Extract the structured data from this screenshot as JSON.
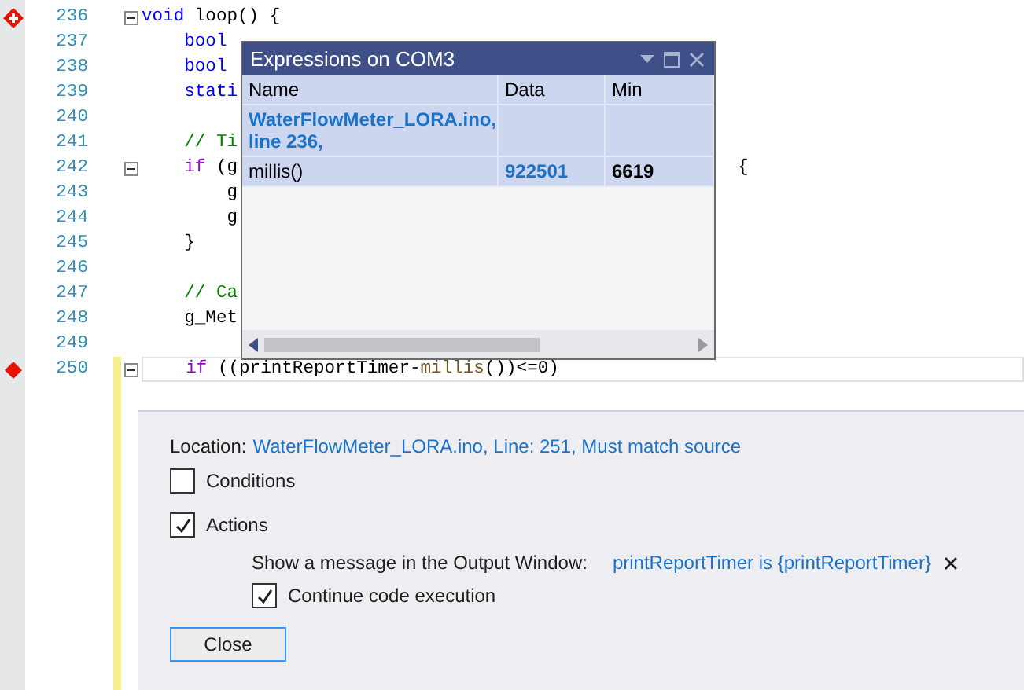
{
  "editor": {
    "lines": [
      {
        "number": "236",
        "breakpoint": {
          "kind": "diamond-plus"
        },
        "foldable": true,
        "changed": false,
        "segments": [
          {
            "kind": "keyword",
            "text": "void"
          },
          {
            "kind": "plain",
            "text": " loop() {"
          }
        ]
      },
      {
        "number": "237",
        "foldable": false,
        "changed": false,
        "segments": [
          {
            "kind": "keyword",
            "text": "    bool"
          }
        ]
      },
      {
        "number": "238",
        "foldable": false,
        "changed": false,
        "segments": [
          {
            "kind": "keyword",
            "text": "    bool"
          }
        ]
      },
      {
        "number": "239",
        "foldable": false,
        "changed": false,
        "segments": [
          {
            "kind": "keyword",
            "text": "    stati"
          }
        ]
      },
      {
        "number": "240",
        "foldable": false,
        "changed": false
      },
      {
        "number": "241",
        "foldable": false,
        "changed": false,
        "segments": [
          {
            "kind": "comment",
            "text": "    // Ti"
          }
        ]
      },
      {
        "number": "242",
        "foldable": true,
        "changed": false,
        "segments": [
          {
            "kind": "control",
            "text": "    if"
          },
          {
            "kind": "plain",
            "text": " (g"
          }
        ],
        "tail": "{"
      },
      {
        "number": "243",
        "foldable": false,
        "changed": false,
        "segments": [
          {
            "kind": "plain",
            "text": "        g"
          }
        ]
      },
      {
        "number": "244",
        "foldable": false,
        "changed": false,
        "segments": [
          {
            "kind": "plain",
            "text": "        g"
          }
        ]
      },
      {
        "number": "245",
        "foldable": false,
        "changed": false,
        "segments": [
          {
            "kind": "plain",
            "text": "    }"
          }
        ]
      },
      {
        "number": "246",
        "foldable": false,
        "changed": false
      },
      {
        "number": "247",
        "foldable": false,
        "changed": false,
        "segments": [
          {
            "kind": "comment",
            "text": "    // Ca"
          }
        ]
      },
      {
        "number": "248",
        "foldable": false,
        "changed": false,
        "segments": [
          {
            "kind": "plain",
            "text": "    g_Met"
          }
        ]
      },
      {
        "number": "249",
        "foldable": false,
        "changed": false
      },
      {
        "number": "250",
        "breakpoint": {
          "kind": "diamond"
        },
        "foldable": true,
        "changed": true,
        "segments": [
          {
            "kind": "control",
            "text": "    if"
          },
          {
            "kind": "plain",
            "text": " ((printReportTimer-"
          },
          {
            "kind": "func",
            "text": "millis"
          },
          {
            "kind": "plain",
            "text": "())<=0)"
          }
        ]
      }
    ]
  },
  "expressions_window": {
    "title": "Expressions on COM3",
    "columns": [
      "Name",
      "Data",
      "Min"
    ],
    "rows": [
      {
        "kind": "location",
        "cells": [
          "WaterFlowMeter_LORA.ino, line 236,"
        ]
      },
      {
        "kind": "expression",
        "cells": [
          "millis()",
          "922501",
          "6619"
        ]
      }
    ]
  },
  "breakpoint_settings": {
    "location_label": "Location:",
    "location": "WaterFlowMeter_LORA.ino, Line: 251, Must match source",
    "conditions": {
      "label": "Conditions",
      "checked": false
    },
    "actions": {
      "label": "Actions",
      "checked": true
    },
    "message_label": "Show a message in the Output Window:",
    "message": "printReportTimer is {printReportTimer}",
    "continue": {
      "label": "Continue code execution",
      "checked": true
    },
    "close_button": "Close"
  }
}
